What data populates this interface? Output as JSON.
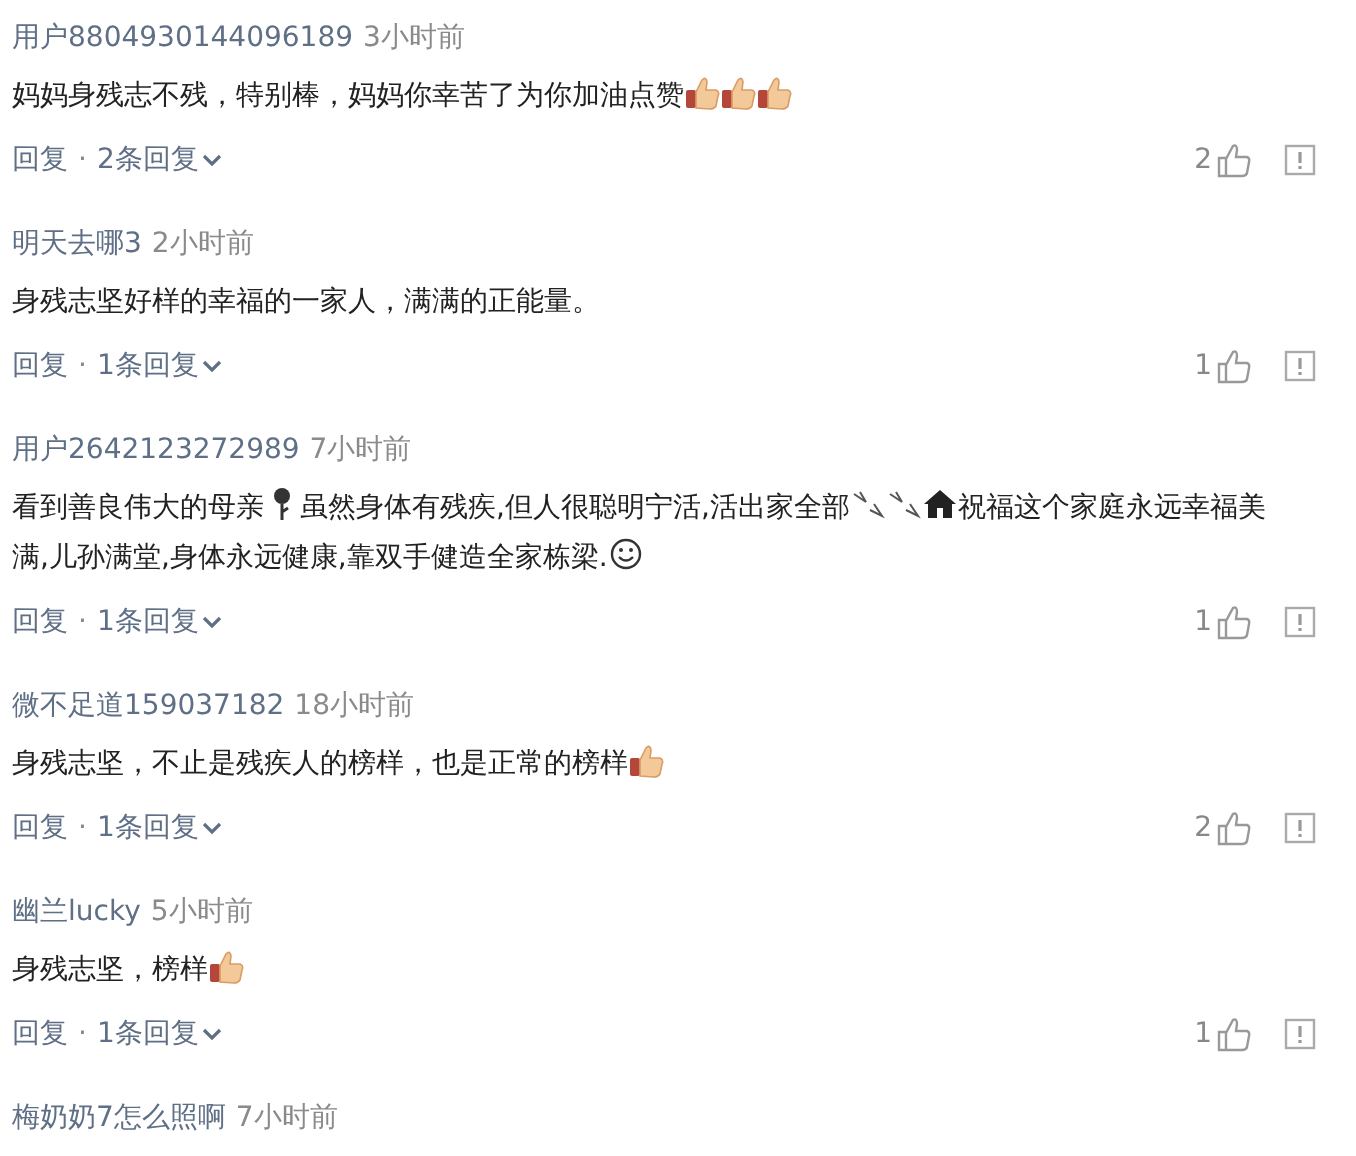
{
  "comments": [
    {
      "user": "用户8804930144096189",
      "time": "3小时前",
      "body": [
        {
          "kind": "text",
          "text": "妈妈身残志不残，特别棒，妈妈你幸苦了为你加油点赞"
        },
        {
          "kind": "thumb"
        },
        {
          "kind": "thumb"
        },
        {
          "kind": "thumb"
        }
      ],
      "reply": "回复",
      "separator": "·",
      "replies": "2条回复",
      "likes": "2"
    },
    {
      "user": "明天去哪3",
      "time": "2小时前",
      "body": [
        {
          "kind": "text",
          "text": "身残志坚好样的幸福的一家人，满满的正能量。"
        }
      ],
      "reply": "回复",
      "separator": "·",
      "replies": "1条回复",
      "likes": "1"
    },
    {
      "user": "用户2642123272989",
      "time": "7小时前",
      "body": [
        {
          "kind": "text",
          "text": "看到善良伟大的母亲"
        },
        {
          "kind": "rose"
        },
        {
          "kind": "text",
          "text": "虽然身体有残疾,但人很聪明宁活,活出家全部"
        },
        {
          "kind": "sparkle"
        },
        {
          "kind": "sparkle"
        },
        {
          "kind": "house"
        },
        {
          "kind": "text",
          "text": "祝福这个家庭永远幸福美满,儿孙满堂,身体永远健康,靠双手健造全家栋梁."
        },
        {
          "kind": "smile"
        }
      ],
      "reply": "回复",
      "separator": "·",
      "replies": "1条回复",
      "likes": "1"
    },
    {
      "user": "微不足道159037182",
      "time": "18小时前",
      "body": [
        {
          "kind": "text",
          "text": "身残志坚，不止是残疾人的榜样，也是正常的榜样"
        },
        {
          "kind": "thumb"
        }
      ],
      "reply": "回复",
      "separator": "·",
      "replies": "1条回复",
      "likes": "2"
    },
    {
      "user": "幽兰lucky",
      "time": "5小时前",
      "body": [
        {
          "kind": "text",
          "text": "身残志坚，榜样"
        },
        {
          "kind": "thumb"
        }
      ],
      "reply": "回复",
      "separator": "·",
      "replies": "1条回复",
      "likes": "1"
    },
    {
      "user": "梅奶奶7怎么照啊",
      "time": "7小时前"
    }
  ]
}
